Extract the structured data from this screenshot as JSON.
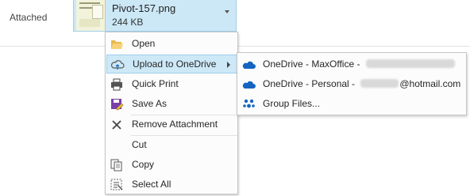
{
  "attached_label": "Attached",
  "attachment": {
    "name": "Pivot-157.png",
    "size": "244 KB"
  },
  "menu": {
    "items": [
      {
        "label": "Open",
        "icon": "folder-open-icon"
      },
      {
        "label": "Upload to OneDrive",
        "icon": "cloud-upload-icon",
        "has_submenu": true,
        "highlighted": true
      },
      {
        "label": "Quick Print",
        "icon": "printer-icon"
      },
      {
        "label": "Save As",
        "icon": "save-as-icon"
      },
      {
        "label": "Remove Attachment",
        "icon": "remove-x-icon"
      },
      {
        "label": "Cut",
        "icon": ""
      },
      {
        "label": "Copy",
        "icon": "copy-icon"
      },
      {
        "label": "Select All",
        "icon": "select-all-icon"
      }
    ]
  },
  "submenu": {
    "items": [
      {
        "label": "OneDrive - MaxOffice - ",
        "icon": "onedrive-icon"
      },
      {
        "label_prefix": "OneDrive - Personal - ",
        "label_suffix": "@hotmail.com",
        "icon": "onedrive-icon"
      },
      {
        "label": "Group Files...",
        "icon": "group-icon"
      }
    ]
  },
  "colors": {
    "highlight": "#cde8f7",
    "onedrive_blue": "#1565c0",
    "accent_border": "#9fcfe9"
  }
}
